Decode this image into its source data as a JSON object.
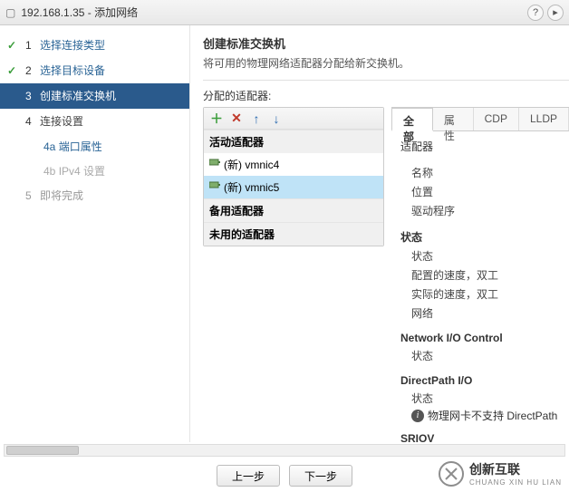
{
  "titlebar": {
    "icon_glyph": "🖥",
    "title": "192.168.1.35 - 添加网络"
  },
  "wizard": {
    "steps": [
      {
        "num": "1",
        "label": "选择连接类型",
        "state": "done"
      },
      {
        "num": "2",
        "label": "选择目标设备",
        "state": "done"
      },
      {
        "num": "3",
        "label": "创建标准交换机",
        "state": "current"
      },
      {
        "num": "4",
        "label": "连接设置",
        "state": "pending",
        "subs": [
          {
            "id": "4a",
            "label": "端口属性",
            "link": true
          },
          {
            "id": "4b",
            "label": "IPv4 设置",
            "link": false
          }
        ]
      },
      {
        "num": "5",
        "label": "即将完成",
        "state": "future"
      }
    ]
  },
  "content": {
    "header": "创建标准交换机",
    "subheader": "将可用的物理网络适配器分配给新交换机。",
    "assigned_label": "分配的适配器:"
  },
  "adapter_panel": {
    "groups": [
      {
        "title": "活动适配器",
        "items": [
          {
            "label": "(新) vmnic4",
            "selected": false
          },
          {
            "label": "(新) vmnic5",
            "selected": true
          }
        ]
      },
      {
        "title": "备用适配器",
        "items": []
      },
      {
        "title": "未用的适配器",
        "items": []
      }
    ]
  },
  "tabs": {
    "items": [
      "全部",
      "属性",
      "CDP",
      "LLDP"
    ],
    "active_index": 0
  },
  "properties": {
    "adapter_label": "适配器",
    "name_label": "名称",
    "location_label": "位置",
    "driver_label": "驱动程序",
    "status_group": "状态",
    "status_label": "状态",
    "cfg_speed_label": "配置的速度，双工",
    "act_speed_label": "实际的速度，双工",
    "network_label": "网络",
    "nioc_group": "Network I/O Control",
    "nioc_status_label": "状态",
    "dp_group": "DirectPath I/O",
    "dp_status_label": "状态",
    "dp_info": "物理网卡不支持 DirectPath",
    "sriov_group": "SRIOV"
  },
  "footer": {
    "back": "上一步",
    "next": "下一步"
  },
  "brand": {
    "cn": "创新互联",
    "py": "CHUANG XIN HU LIAN"
  }
}
